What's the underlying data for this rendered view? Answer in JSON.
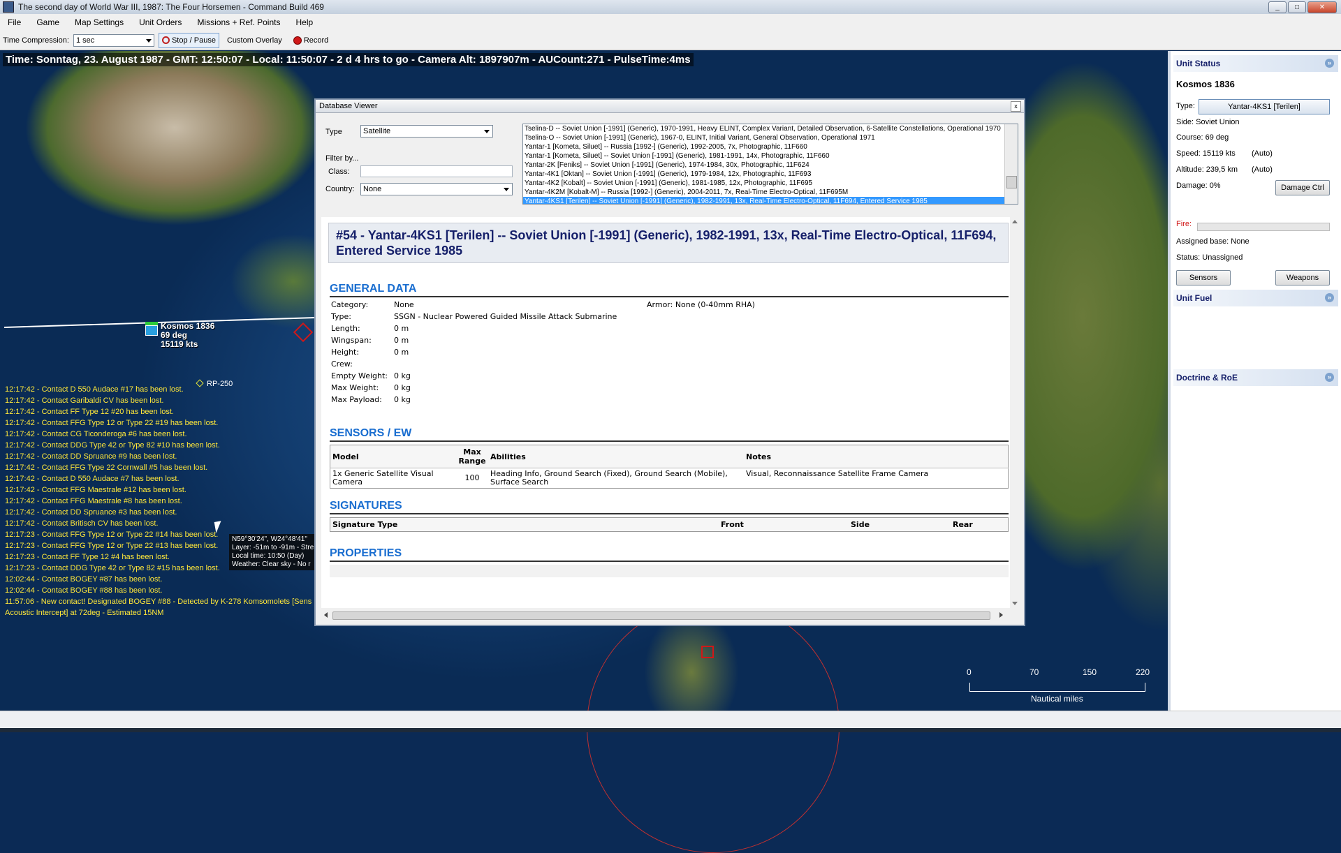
{
  "window": {
    "title": "The second day of World War III, 1987: The Four Horsemen - Command Build 469",
    "minimize": "_",
    "maximize": "□",
    "close": "✕"
  },
  "menu": [
    "File",
    "Game",
    "Map Settings",
    "Unit Orders",
    "Missions + Ref. Points",
    "Help"
  ],
  "toolbar": {
    "time_compression_label": "Time Compression:",
    "time_compression_value": "1 sec",
    "stop_pause": "Stop / Pause",
    "custom_overlay": "Custom Overlay",
    "record": "Record"
  },
  "status_line": "Time: Sonntag, 23. August 1987 - GMT: 12:50:07 - Local: 11:50:07 - 2 d 4 hrs to go -  Camera Alt: 1897907m - AUCount:271 - PulseTime:4ms",
  "map": {
    "unit_label": {
      "name": "Kosmos 1836",
      "course": "69 deg",
      "speed": "15119 kts"
    },
    "ref_point": "RP-250",
    "cursor_tooltip": [
      "N59°30'24\", W24°48'41\"",
      "Layer: -51m to -91m - Stre",
      "Local time: 10:50 (Day)",
      "Weather: Clear sky - No r"
    ],
    "scale": {
      "ticks": [
        "0",
        "70",
        "150",
        "220"
      ],
      "units": "Nautical miles"
    }
  },
  "message_log": [
    "12:17:42 - Contact D 550 Audace #17 has been lost.",
    "12:17:42 - Contact Garibaldi CV has been lost.",
    "12:17:42 - Contact FF Type 12 #20 has been lost.",
    "12:17:42 - Contact FFG Type 12 or Type 22 #19 has been lost.",
    "12:17:42 - Contact CG Ticonderoga #6 has been lost.",
    "12:17:42 - Contact DDG Type 42 or Type 82 #10 has been lost.",
    "12:17:42 - Contact DD Spruance #9 has been lost.",
    "12:17:42 - Contact FFG Type 22 Cornwall #5 has been lost.",
    "12:17:42 - Contact D 550 Audace #7 has been lost.",
    "12:17:42 - Contact FFG Maestrale #12 has been lost.",
    "12:17:42 - Contact FFG Maestrale #8 has been lost.",
    "12:17:42 - Contact DD Spruance #3 has been lost.",
    "12:17:42 - Contact Britisch CV has been lost.",
    "12:17:23 - Contact FFG Type 12 or Type 22 #14 has been lost.",
    "12:17:23 - Contact FFG Type 12 or Type 22 #13 has been lost.",
    "12:17:23 - Contact FF Type 12 #4 has been lost.",
    "12:17:23 - Contact DDG Type 42 or Type 82 #15 has been lost.",
    "12:02:44 - Contact BOGEY #87 has been lost.",
    "12:02:44 - Contact BOGEY #88 has been lost.",
    "11:57:06 - New contact! Designated BOGEY #88 - Detected by K-278 Komsomolets [Sens",
    "Acoustic Intercept] at 72deg - Estimated 15NM"
  ],
  "database_viewer": {
    "title": "Database Viewer",
    "close": "x",
    "type_label": "Type",
    "type_value": "Satellite",
    "filter_by": "Filter by...",
    "class_label": "Class:",
    "country_label": "Country:",
    "country_value": "None",
    "list": [
      "Tselina-D -- Soviet Union [-1991] (Generic), 1970-1991, Heavy ELINT, Complex Variant, Detailed Observation, 6-Satellite Constellations, Operational 1970",
      "Tselina-O -- Soviet Union [-1991] (Generic), 1967-0, ELINT, Initial Variant, General Observation, Operational 1971",
      "Yantar-1 [Kometa, Siluet] -- Russia [1992-] (Generic), 1992-2005, 7x, Photographic, 11F660",
      "Yantar-1 [Kometa, Siluet] -- Soviet Union [-1991] (Generic), 1981-1991, 14x, Photographic, 11F660",
      "Yantar-2K [Feniks] -- Soviet Union [-1991] (Generic), 1974-1984, 30x, Photographic, 11F624",
      "Yantar-4K1 [Oktan] -- Soviet Union [-1991] (Generic), 1979-1984, 12x, Photographic, 11F693",
      "Yantar-4K2 [Kobalt] -- Soviet Union [-1991] (Generic), 1981-1985, 12x, Photographic, 11F695",
      "Yantar-4K2M [Kobalt-M] -- Russia [1992-] (Generic), 2004-2011, 7x, Real-Time Electro-Optical, 11F695M",
      "Yantar-4KS1 [Terilen] -- Soviet Union [-1991] (Generic), 1982-1991, 13x, Real-Time Electro-Optical, 11F694, Entered Service 1985"
    ],
    "selected_index": 8,
    "record_title": "#54 - Yantar-4KS1 [Terilen] -- Soviet Union [-1991] (Generic), 1982-1991, 13x, Real-Time Electro-Optical, 11F694, Entered Service 1985",
    "general_heading": "GENERAL DATA",
    "general": [
      {
        "k": "Category:",
        "v": "None"
      },
      {
        "k": "Type:",
        "v": "SSGN - Nuclear Powered Guided Missile Attack Submarine"
      },
      {
        "k": "Length:",
        "v": "0 m"
      },
      {
        "k": "Wingspan:",
        "v": "0 m"
      },
      {
        "k": "Height:",
        "v": "0 m"
      },
      {
        "k": "Crew:",
        "v": ""
      },
      {
        "k": "Empty Weight:",
        "v": "0 kg"
      },
      {
        "k": "Max Weight:",
        "v": "0 kg"
      },
      {
        "k": "Max Payload:",
        "v": "0 kg"
      }
    ],
    "armor": "Armor: None (0-40mm RHA)",
    "sensors_heading": "SENSORS / EW",
    "sensors_cols": [
      "Model",
      "Max Range",
      "Abilities",
      "Notes"
    ],
    "sensors_rows": [
      {
        "model": "1x Generic Satellite Visual Camera",
        "range": "100",
        "abilities": "Heading Info, Ground Search (Fixed), Ground Search (Mobile), Surface Search",
        "notes": "Visual, Reconnaissance Satellite Frame Camera"
      }
    ],
    "signatures_heading": "SIGNATURES",
    "signatures_cols": [
      "Signature Type",
      "Front",
      "Side",
      "Rear"
    ],
    "properties_heading": "PROPERTIES"
  },
  "unit_status": {
    "header": "Unit Status",
    "name": "Kosmos 1836",
    "type_label": "Type:",
    "type_value": "Yantar-4KS1 [Terilen]",
    "side": "Side: Soviet Union",
    "course": "Course: 69 deg",
    "speed": "Speed: 15119 kts",
    "speed_mode": "(Auto)",
    "altitude": "Altitude: 239,5 km",
    "altitude_mode": "(Auto)",
    "damage": "Damage: 0%",
    "damage_btn": "Damage Ctrl",
    "fire": "Fire:",
    "assigned_base": "Assigned base: None",
    "status": "Status: Unassigned",
    "sensors_btn": "Sensors",
    "weapons_btn": "Weapons"
  },
  "unit_fuel": {
    "header": "Unit Fuel"
  },
  "doctrine": {
    "header": "Doctrine & RoE"
  },
  "colors": {
    "accent": "#1a6ed0",
    "log_text": "#ffe83a",
    "hostile": "#d01818",
    "friendly": "#2ecc3c"
  }
}
